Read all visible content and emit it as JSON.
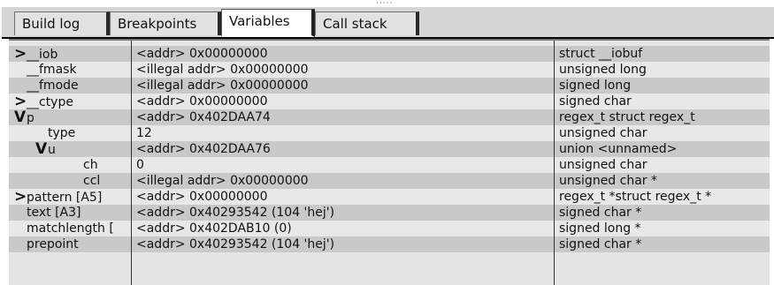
{
  "tabs": [
    {
      "label": "Build log"
    },
    {
      "label": "Breakpoints"
    },
    {
      "label": "Variables"
    },
    {
      "label": "Call stack"
    }
  ],
  "active_tab": "Variables",
  "grip": "·····",
  "variables": [
    {
      "marker": ">",
      "name": "__iob",
      "value": "<addr> 0x00000000",
      "type": "struct __iobuf"
    },
    {
      "marker": "",
      "name": "__fmask",
      "value": "<illegal addr> 0x00000000",
      "type": "unsigned long"
    },
    {
      "marker": "",
      "name": "__fmode",
      "value": "<illegal addr> 0x00000000",
      "type": "signed long"
    },
    {
      "marker": ">",
      "name": "__ctype",
      "value": "<addr> 0x00000000",
      "type": "signed char"
    },
    {
      "marker": "V",
      "name": "p",
      "value": "<addr> 0x402DAA74",
      "type": "regex_t struct regex_t"
    },
    {
      "marker": "",
      "name": "type",
      "value": "12",
      "type": "unsigned char"
    },
    {
      "marker": "V",
      "name": "u",
      "value": "<addr> 0x402DAA76",
      "type": "union <unnamed>"
    },
    {
      "marker": "",
      "name": "ch",
      "value": "0",
      "type": "unsigned char"
    },
    {
      "marker": "",
      "name": "ccl",
      "value": "<illegal addr> 0x00000000",
      "type": "unsigned char *"
    },
    {
      "marker": ">",
      "name": "pattern [A5]",
      "value": "<addr> 0x00000000",
      "type": "regex_t *struct regex_t *"
    },
    {
      "marker": "",
      "name": "text [A3]",
      "value": "<addr> 0x40293542 (104 'hej')",
      "type": "signed char *"
    },
    {
      "marker": "",
      "name": "matchlength [",
      "value": "<addr> 0x402DAB10 (0)",
      "type": "signed long *"
    },
    {
      "marker": "",
      "name": "prepoint",
      "value": "<addr> 0x40293542 (104 'hej')",
      "type": "signed char *"
    }
  ]
}
